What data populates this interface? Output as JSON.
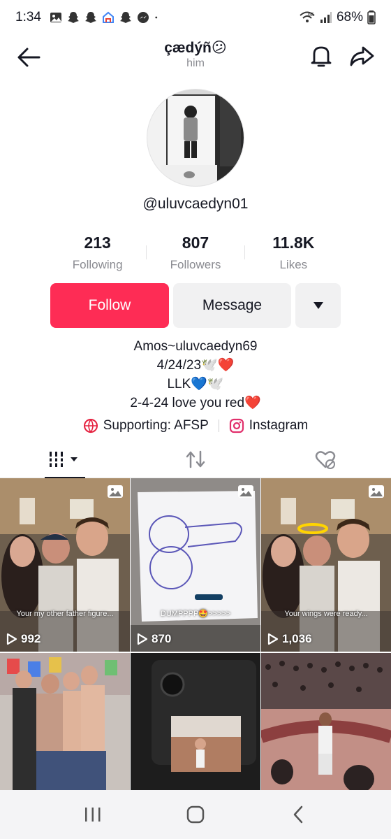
{
  "status_bar": {
    "time": "1:34",
    "battery": "68%",
    "network": "6E"
  },
  "header": {
    "display_name": "çædýñ😕",
    "pronoun": "him"
  },
  "profile": {
    "username": "@uluvcaedyn01"
  },
  "stats": [
    {
      "value": "213",
      "label": "Following"
    },
    {
      "value": "807",
      "label": "Followers"
    },
    {
      "value": "11.8K",
      "label": "Likes"
    }
  ],
  "actions": {
    "follow": "Follow",
    "message": "Message"
  },
  "bio": {
    "line1": "Amos~uluvcaedyn69",
    "line2": "4/24/23🕊️❤️",
    "line3": "LLK💙🕊️",
    "line4": "2-4-24 love you red❤️"
  },
  "links": {
    "supporting": "Supporting: AFSP",
    "instagram": "Instagram"
  },
  "videos": [
    {
      "caption": "Your my other father figure...",
      "views": "992"
    },
    {
      "caption": "DUMPPPP🤩>>>>>",
      "views": "870"
    },
    {
      "caption": "Your wings were ready...",
      "views": "1,036"
    },
    {
      "caption": "",
      "views": ""
    },
    {
      "caption": "",
      "views": ""
    },
    {
      "caption": "",
      "views": ""
    }
  ],
  "colors": {
    "accent": "#fe2c55",
    "secondary_button": "#f1f1f2",
    "muted_text": "#8a8b91"
  }
}
